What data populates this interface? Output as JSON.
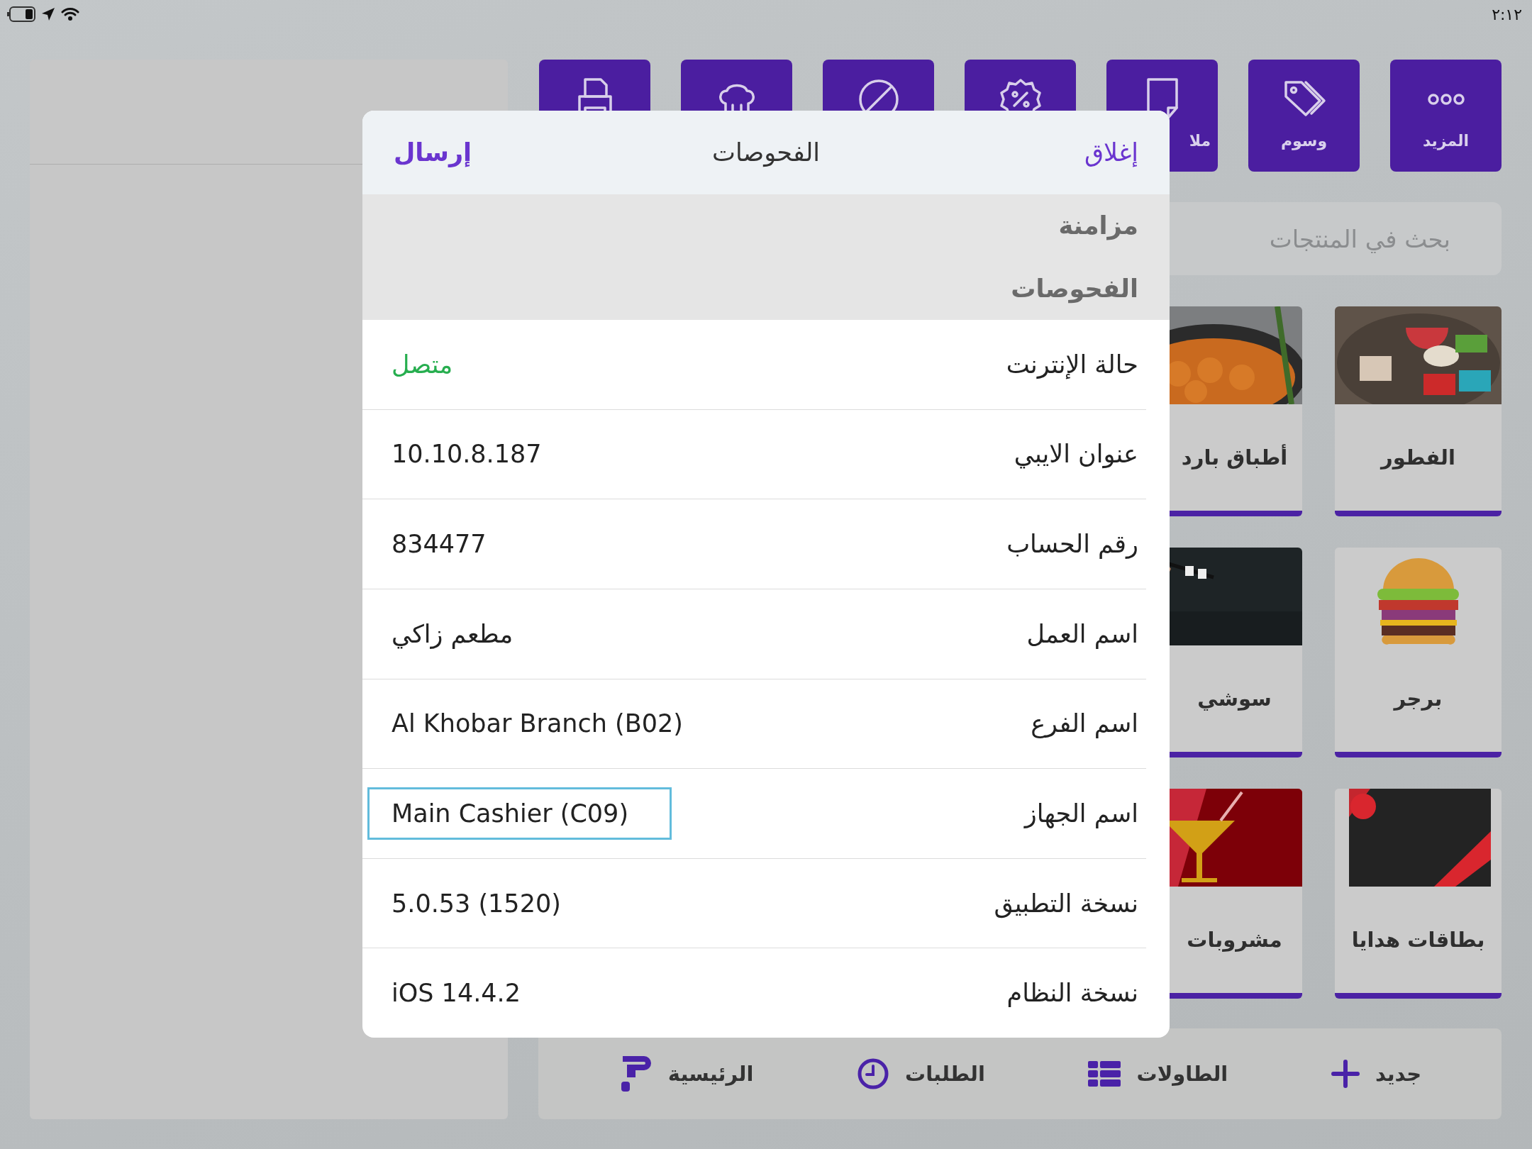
{
  "status_bar": {
    "time": "٢:١٢"
  },
  "toolbar_buttons": [
    {
      "kind": "labeled",
      "label": "المزيد"
    },
    {
      "kind": "labeled",
      "label": "وسوم"
    },
    {
      "kind": "labeled",
      "label": "ملا"
    },
    {
      "kind": "icon"
    },
    {
      "kind": "icon"
    },
    {
      "kind": "icon"
    },
    {
      "kind": "icon"
    }
  ],
  "search": {
    "placeholder": "بحث في المنتجات"
  },
  "categories": [
    {
      "label": "الفطور"
    },
    {
      "label": "أطباق بارد"
    },
    {
      "label": "برجر"
    },
    {
      "label": "سوشي"
    },
    {
      "label": "بطاقات هدايا"
    },
    {
      "label": "مشروبات"
    }
  ],
  "bottom_nav": [
    {
      "label": "جديد"
    },
    {
      "label": "الطاولات"
    },
    {
      "label": "الطلبات"
    },
    {
      "label": "الرئيسية"
    }
  ],
  "dialog": {
    "close": "إغلاق",
    "title": "الفحوصات",
    "send": "إرسال",
    "sections": [
      "مزامنة",
      "الفحوصات"
    ],
    "rows": [
      {
        "kind": "status",
        "label": "حالة الإنترنت",
        "value": "متصل",
        "focused": false
      },
      {
        "kind": "text",
        "label": "عنوان الايبي",
        "value": "10.10.8.187",
        "focused": false
      },
      {
        "kind": "text",
        "label": "رقم الحساب",
        "value": "834477",
        "focused": false
      },
      {
        "kind": "text",
        "label": "اسم العمل",
        "value": "مطعم زاكي",
        "focused": false
      },
      {
        "kind": "text",
        "label": "اسم الفرع",
        "value": "Al Khobar Branch (B02)",
        "focused": false
      },
      {
        "kind": "text",
        "label": "اسم الجهاز",
        "value": "Main Cashier (C09)",
        "focused": true
      },
      {
        "kind": "text",
        "label": "نسخة التطبيق",
        "value": "5.0.53 (1520)",
        "focused": false
      },
      {
        "kind": "text",
        "label": "نسخة النظام",
        "value": "iOS 14.4.2",
        "focused": false
      }
    ]
  }
}
